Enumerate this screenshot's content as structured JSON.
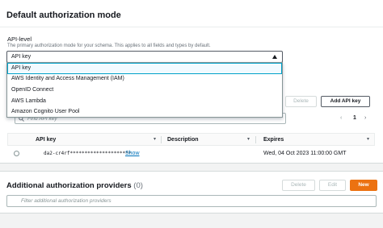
{
  "default_auth": {
    "title": "Default authorization mode",
    "field_label": "API-level",
    "field_description": "The primary authorization mode for your schema. This applies to all fields and types by default.",
    "selected_value": "API key",
    "options": [
      "API key",
      "AWS Identity and Access Management (IAM)",
      "OpenID Connect",
      "AWS Lambda",
      "Amazon Cognito User Pool"
    ]
  },
  "api_keys": {
    "delete_label": "Delete",
    "add_label": "Add API key",
    "search_placeholder": "Find API key",
    "page_number": "1",
    "columns": [
      "API key",
      "Description",
      "Expires"
    ],
    "rows": [
      {
        "key": "da2-cr4rf*********************",
        "show_label": "Show",
        "description": "",
        "expires": "Wed, 04 Oct 2023 11:00:00 GMT"
      }
    ]
  },
  "additional": {
    "title": "Additional authorization providers",
    "count": "(0)",
    "delete_label": "Delete",
    "edit_label": "Edit",
    "new_label": "New",
    "filter_placeholder": "Filter additional authorization providers"
  },
  "colors": {
    "accent_orange": "#ec7211",
    "link_blue": "#0073bb",
    "selected_border": "#00a1c9"
  }
}
